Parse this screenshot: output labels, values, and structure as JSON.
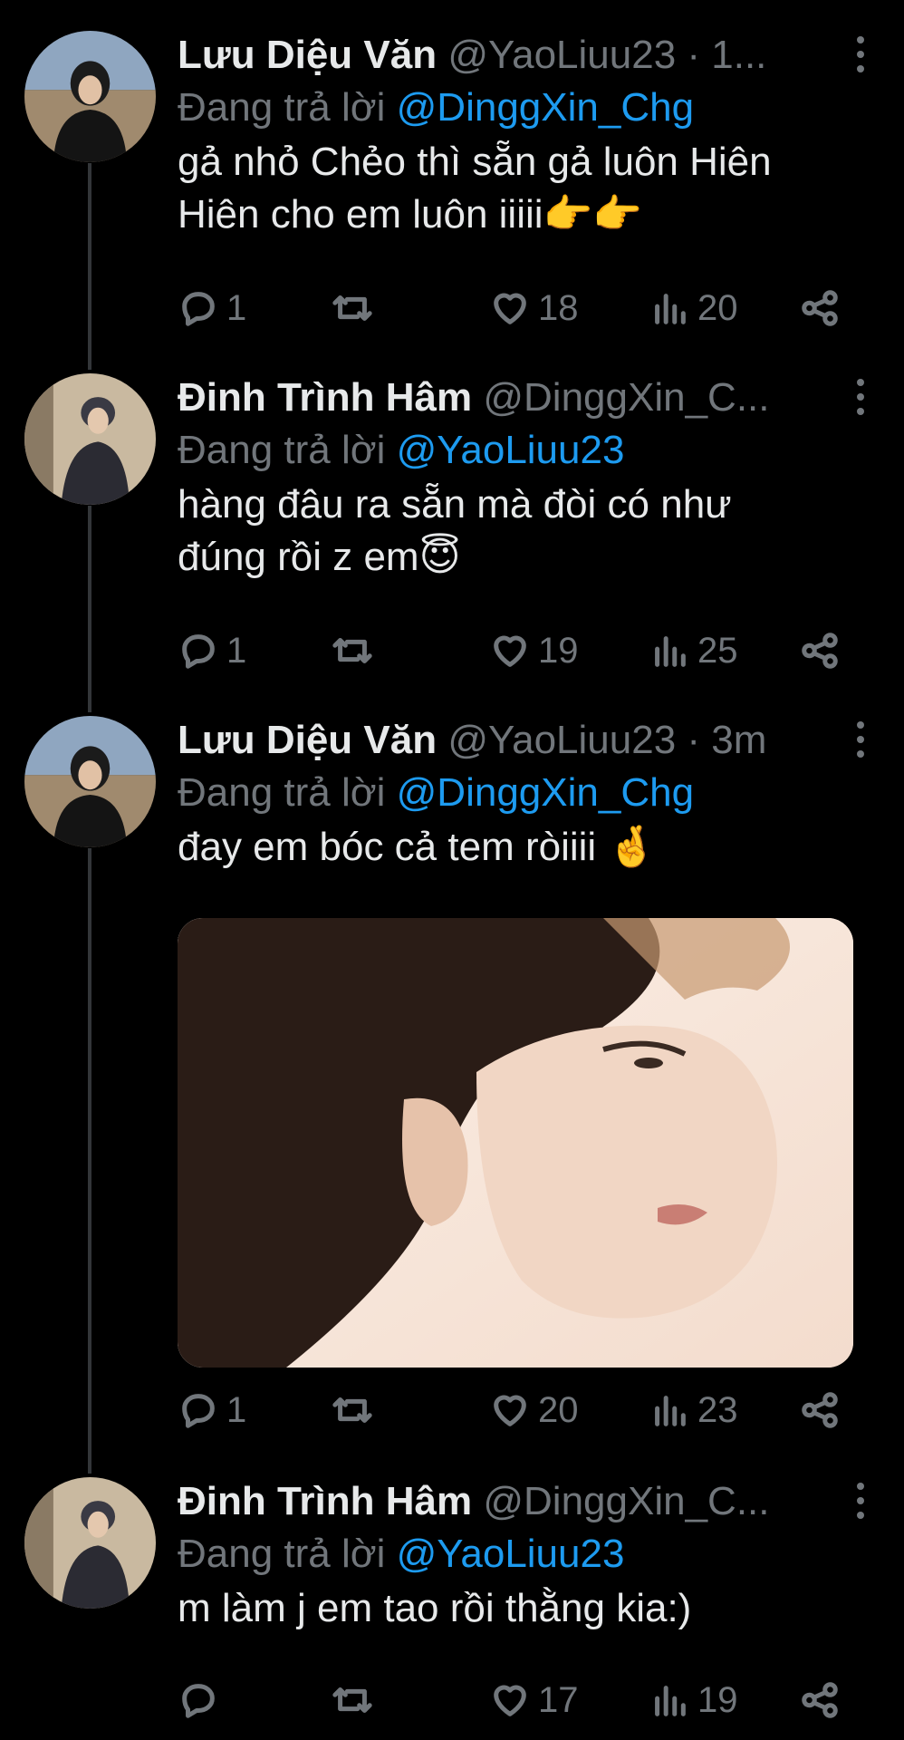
{
  "tweets": [
    {
      "name": "Lưu Diệu Văn",
      "handle": "@YaoLiuu23 · 1...",
      "reply_prefix": "Đang trả lời",
      "reply_mention": "@DinggXin_Chg",
      "text_line1": "gả nhỏ Chẻo thì sẵn gả luôn Hiên",
      "text_line2": "Hiên cho em luôn iiiii",
      "emoji": "👉👉",
      "replies": "1",
      "retweets": "",
      "likes": "18",
      "views": "20"
    },
    {
      "name": "Đinh Trình Hâm",
      "handle": "@DinggXin_C...",
      "reply_prefix": "Đang trả lời",
      "reply_mention": "@YaoLiuu23",
      "text_line1": "hàng đâu ra sẵn mà đòi có như",
      "text_line2": "đúng rồi z em",
      "emoji": "😇",
      "replies": "1",
      "retweets": "",
      "likes": "19",
      "views": "25"
    },
    {
      "name": "Lưu Diệu Văn",
      "handle": "@YaoLiuu23 · 3m",
      "reply_prefix": "Đang trả lời",
      "reply_mention": "@DinggXin_Chg",
      "text_line1": "đay em bóc cả tem ròiiii",
      "emoji": "🤞",
      "replies": "1",
      "retweets": "",
      "likes": "20",
      "views": "23"
    },
    {
      "name": "Đinh Trình Hâm",
      "handle": "@DinggXin_C...",
      "reply_prefix": "Đang trả lời",
      "reply_mention": "@YaoLiuu23",
      "text_line1": "m làm j em tao rồi thằng kia:)",
      "replies": "",
      "retweets": "",
      "likes": "17",
      "views": "19"
    }
  ],
  "icons": {
    "reply": "reply-icon",
    "retweet": "retweet-icon",
    "like": "heart-icon",
    "views": "views-chart-icon",
    "share": "share-icon",
    "more": "more-dots-icon"
  },
  "colors": {
    "background": "#000000",
    "text": "#e7e9ea",
    "muted": "#71767b",
    "mention": "#1d9bf0",
    "thread_line": "#333639"
  }
}
